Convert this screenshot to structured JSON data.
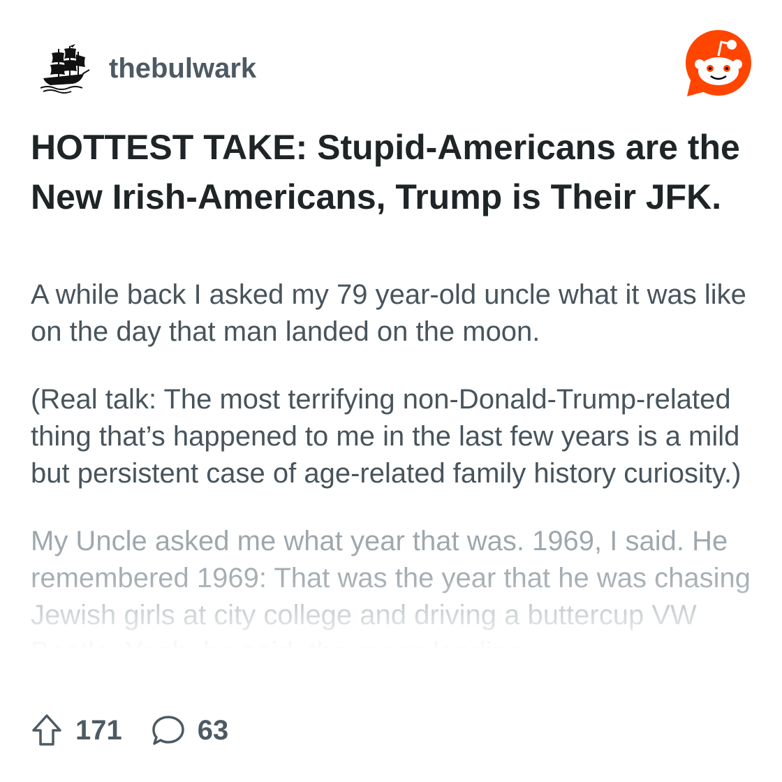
{
  "post": {
    "username": "thebulwark",
    "title": "HOTTEST TAKE: Stupid-Americans are the New Irish-Americans, Trump is Their JFK.",
    "paragraphs": [
      "A while back I asked my 79 year-old uncle what it was like on the day that man landed on the moon.",
      "(Real talk: The most terrifying non-Donald-Trump-related thing that’s happened to me in the last few years is a mild but persistent case of age-related family history curiosity.)",
      "My Uncle asked me what year that was. 1969, I said. He remembered 1969: That was the year that he was chasing Jewish girls at city college and driving a buttercup VW Beetle. Yeah, he said, the moon landing"
    ]
  },
  "stats": {
    "upvotes": "171",
    "comments": "63"
  },
  "icons": {
    "avatar": "pirate-ship-icon",
    "brand": "reddit-snoo-icon",
    "upvote": "upvote-arrow-icon",
    "comment": "comment-bubble-icon"
  },
  "colors": {
    "reddit_orange": "#ff4500",
    "text_dark": "#1f2427",
    "text_body": "#48545c",
    "meta": "#4d5a63"
  }
}
